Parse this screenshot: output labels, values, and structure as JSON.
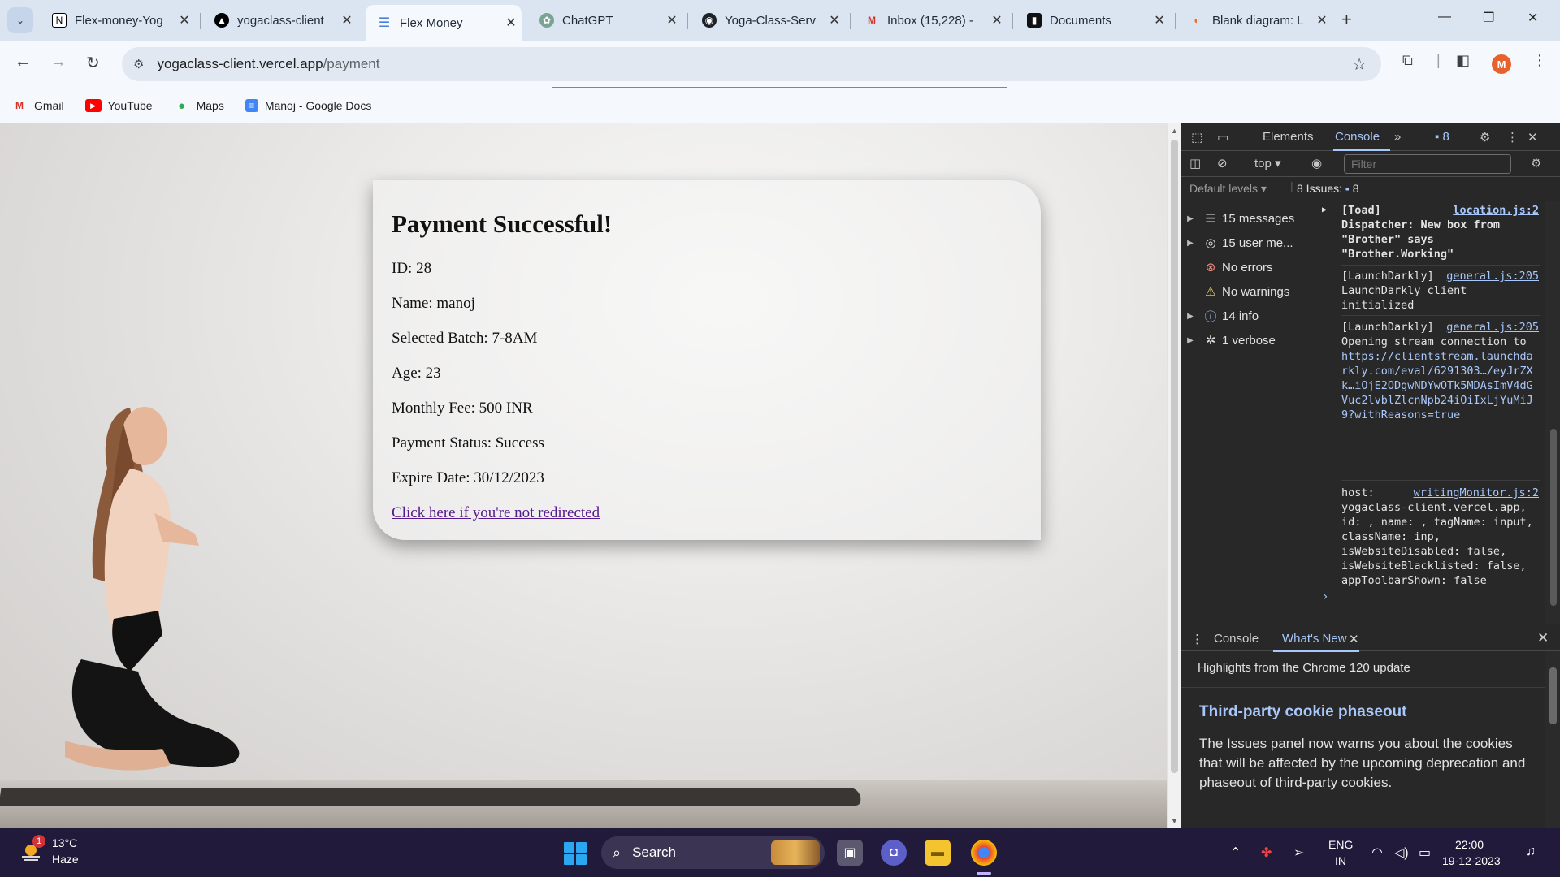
{
  "browser": {
    "tabs": [
      {
        "title": "Flex-money-Yog",
        "favicon": "notion-icon"
      },
      {
        "title": "yogaclass-client",
        "favicon": "vercel-icon"
      },
      {
        "title": "Flex Money",
        "favicon": "docs-lines-icon",
        "active": true
      },
      {
        "title": "ChatGPT",
        "favicon": "chatgpt-icon"
      },
      {
        "title": "Yoga-Class-Serv",
        "favicon": "github-icon"
      },
      {
        "title": "Inbox (15,228) -",
        "favicon": "gmail-icon"
      },
      {
        "title": "Documents",
        "favicon": "documents-icon"
      },
      {
        "title": "Blank diagram: L",
        "favicon": "diagram-icon"
      }
    ],
    "url_host": "yogaclass-client.vercel.app",
    "url_path": "/payment",
    "profile_initial": "M",
    "bookmarks": [
      {
        "label": "Gmail",
        "icon": "gmail-icon"
      },
      {
        "label": "YouTube",
        "icon": "youtube-icon"
      },
      {
        "label": "Maps",
        "icon": "maps-pin-icon"
      },
      {
        "label": "Manoj - Google Docs",
        "icon": "google-docs-icon"
      }
    ]
  },
  "page": {
    "title": "Payment Successful!",
    "fields": [
      "ID: 28",
      "Name: manoj",
      "Selected Batch: 7-8AM",
      "Age: 23",
      "Monthly Fee: 500 INR",
      "Payment Status: Success",
      "Expire Date: 30/12/2023"
    ],
    "redirect_link": "Click here if you're not redirected"
  },
  "devtools": {
    "tabs": [
      "Elements",
      "Console"
    ],
    "active_tab": "Console",
    "issues_badge": "8",
    "context": "top",
    "filter_placeholder": "Filter",
    "default_levels": "Default levels",
    "issues_label": "8 Issues:",
    "issues_count": "8",
    "sidebar": [
      {
        "label": "15 messages",
        "icon": "list-icon",
        "expandable": true
      },
      {
        "label": "15 user me...",
        "icon": "user-circle-icon",
        "expandable": true
      },
      {
        "label": "No errors",
        "icon": "error-icon",
        "expandable": false
      },
      {
        "label": "No warnings",
        "icon": "warning-icon",
        "expandable": false
      },
      {
        "label": "14 info",
        "icon": "info-icon",
        "expandable": true
      },
      {
        "label": "1 verbose",
        "icon": "bug-icon",
        "expandable": true
      }
    ],
    "messages": [
      {
        "source": "location.js:2",
        "text": "[Toad] Dispatcher: New box from \"Brother\" says \"Brother.Working\""
      },
      {
        "source": "general.js:205",
        "text": "[LaunchDarkly] LaunchDarkly client initialized"
      },
      {
        "source": "general.js:205",
        "text": "[LaunchDarkly] Opening stream connection to ",
        "link": "https://clientstream.launchdarkly.com/eval/6291303…/eyJrZXk…iOjE2ODgwNDYwOTk5MDAsImV4dGVuc2lvblZlcnNpb24iOiIxLjYuMiJ9?withReasons=true"
      },
      {
        "source": "writingMonitor.js:2",
        "text": "host: yogaclass-client.vercel.app, id: , name: , tagName: input, className: inp, isWebsiteDisabled: false, isWebsiteBlacklisted: false, appToolbarShown: false"
      }
    ],
    "drawer_tabs": [
      "Console",
      "What's New"
    ],
    "drawer_active": "What's New",
    "whats_new_highlight": "Highlights from the Chrome 120 update",
    "whats_new_title": "Third-party cookie phaseout",
    "whats_new_body": "The Issues panel now warns you about the cookies that will be affected by the upcoming deprecation and phaseout of third-party cookies."
  },
  "taskbar": {
    "weather_badge": "1",
    "temperature": "13°C",
    "condition": "Haze",
    "search_label": "Search",
    "language": "ENG",
    "region": "IN",
    "time": "22:00",
    "date": "19-12-2023"
  },
  "colors": {
    "devtools_bg": "#282828",
    "devtools_accent": "#a8c7fa",
    "link_visited": "#551a8b",
    "taskbar_bg": "#221a3a"
  }
}
